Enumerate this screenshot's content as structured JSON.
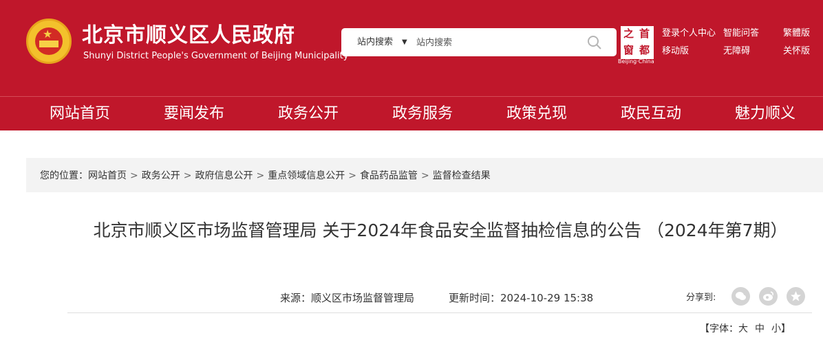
{
  "site": {
    "title_cn": "北京市顺义区人民政府",
    "title_en": "Shunyi District People's Government of Beijing Municipality"
  },
  "search": {
    "scope_label": "站内搜索",
    "placeholder": "站内搜索"
  },
  "badge": {
    "chars": [
      "之",
      "首",
      "窗",
      "都"
    ],
    "caption": "Beijing·China"
  },
  "top_links": {
    "login": "登录个人中心",
    "qa": "智能问答",
    "traditional": "繁體版",
    "mobile": "移动版",
    "accessible": "无障碍",
    "elderly": "关怀版"
  },
  "nav": {
    "items": [
      "网站首页",
      "要闻发布",
      "政务公开",
      "政务服务",
      "政策兑现",
      "政民互动",
      "魅力顺义"
    ]
  },
  "breadcrumb": {
    "prefix": "您的位置：",
    "items": [
      "网站首页",
      "政务公开",
      "政府信息公开",
      "重点领域信息公开",
      "食品药品监管",
      "监督检查结果"
    ],
    "separator": ">"
  },
  "article": {
    "title": "北京市顺义区市场监督管理局 关于2024年食品安全监督抽检信息的公告 （2024年第7期）",
    "source": "来源：顺义区市场监督管理局",
    "updated": "更新时间：2024-10-29 15:38",
    "share_label": "分享到:"
  },
  "font_size": {
    "label": "【字体：",
    "large": "大",
    "medium": "中",
    "small": "小",
    "close": "】"
  },
  "colors": {
    "brand_red": "#c0172b",
    "breadcrumb_bg": "#f3f3f3"
  },
  "icons": [
    "national-emblem-icon",
    "chevron-down-icon",
    "search-icon",
    "wechat-icon",
    "weibo-icon",
    "qzone-icon"
  ]
}
